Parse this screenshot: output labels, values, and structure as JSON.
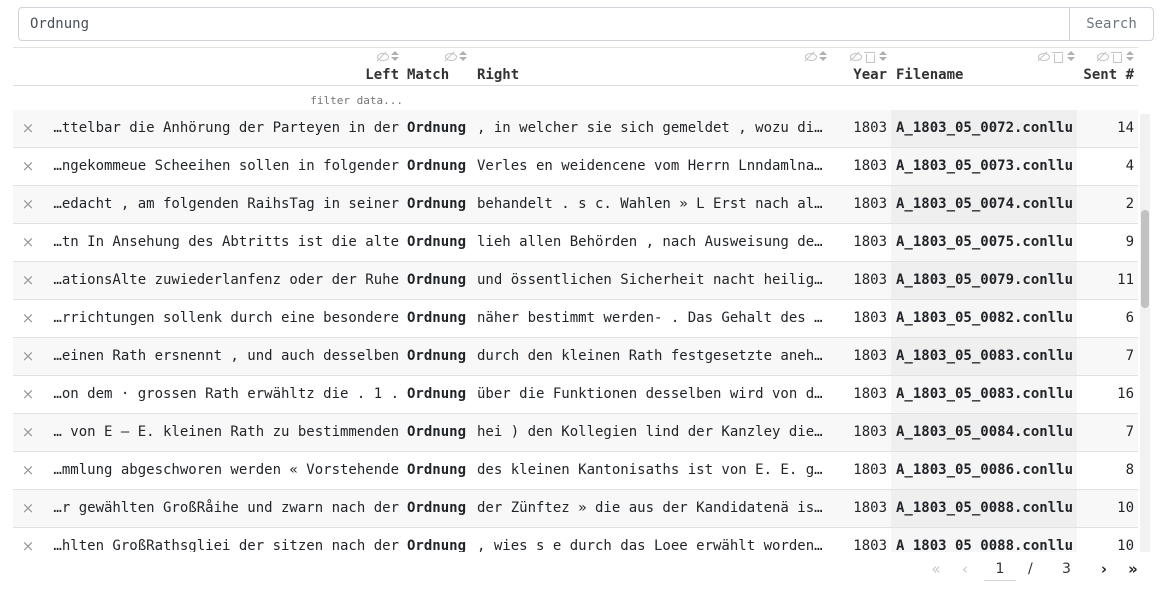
{
  "search": {
    "value": "Ordnung",
    "button_label": "Search"
  },
  "columns": {
    "left": "Left",
    "match": "Match",
    "right": "Right",
    "year": "Year",
    "filename": "Filename",
    "sent": "Sent #"
  },
  "filter": {
    "placeholder": "filter data..."
  },
  "row_close_glyph": "×",
  "rows": [
    {
      "left": "…ttelbar die Anhörung der Parteyen in der",
      "match": "Ordnung",
      "right": ", in welcher sie sich gemeldet , wozu di…",
      "year": "1803",
      "filename": "A_1803_05_0072.conllu",
      "sent": "14"
    },
    {
      "left": "…ngekommeue Scheeihen sollen in folgender",
      "match": "Ordnung",
      "right": "Verles en weidencene vom Herrn Lnndamlna…",
      "year": "1803",
      "filename": "A_1803_05_0073.conllu",
      "sent": "4"
    },
    {
      "left": "…edacht , am folgenden RaihsTag in seiner",
      "match": "Ordnung",
      "right": "behandelt . s c. Wahlen » L Erst nach al…",
      "year": "1803",
      "filename": "A_1803_05_0074.conllu",
      "sent": "2"
    },
    {
      "left": "…tn In Ansehung des Abtritts ist die alte",
      "match": "Ordnung",
      "right": "lieh allen Behörden , nach Ausweisung de…",
      "year": "1803",
      "filename": "A_1803_05_0075.conllu",
      "sent": "9"
    },
    {
      "left": "…ationsAlte zuwiederlanfenz oder der Ruhe",
      "match": "Ordnung",
      "right": "und össentlichen Sicherheit nacht heilig…",
      "year": "1803",
      "filename": "A_1803_05_0079.conllu",
      "sent": "11"
    },
    {
      "left": "…rrichtungen sollenk durch eine besondere",
      "match": "Ordnung",
      "right": "näher bestimmt werden- . Das Gehalt des …",
      "year": "1803",
      "filename": "A_1803_05_0082.conllu",
      "sent": "6"
    },
    {
      "left": "…einen Rath ersnennt , und auch desselben",
      "match": "Ordnung",
      "right": "durch den kleinen Rath festgesetzte aneh…",
      "year": "1803",
      "filename": "A_1803_05_0083.conllu",
      "sent": "7"
    },
    {
      "left": "…on dem · grossen Rath erwähltz die . 1 .",
      "match": "Ordnung",
      "right": "über die Funktionen desselben wird von d…",
      "year": "1803",
      "filename": "A_1803_05_0083.conllu",
      "sent": "16"
    },
    {
      "left": "… von E — E. kleinen Rath zu bestimmenden",
      "match": "Ordnung",
      "right": "hei ) den Kollegien lind der Kanzley die…",
      "year": "1803",
      "filename": "A_1803_05_0084.conllu",
      "sent": "7"
    },
    {
      "left": "…mmlung abgeschworen werden « Vorstehende",
      "match": "Ordnung",
      "right": "des kleinen Kantonisaths ist von E. E. g…",
      "year": "1803",
      "filename": "A_1803_05_0086.conllu",
      "sent": "8"
    },
    {
      "left": "…r gewählten GroßRåihe und zwarn nach der",
      "match": "Ordnung",
      "right": "der Zünftez » die aus der Kandidatenä is…",
      "year": "1803",
      "filename": "A_1803_05_0088.conllu",
      "sent": "10"
    },
    {
      "left": "…hlten GroßRathsgliei der sitzen nach der",
      "match": "Ordnung",
      "right": ", wies s e durch das Loee erwählt worden…",
      "year": "1803",
      "filename": "A_1803_05_0088.conllu",
      "sent": "10"
    }
  ],
  "pagination": {
    "first_glyph": "«",
    "prev_glyph": "‹",
    "next_glyph": "›",
    "last_glyph": "»",
    "current_page": "1",
    "separator": "/",
    "total_pages": "3"
  }
}
